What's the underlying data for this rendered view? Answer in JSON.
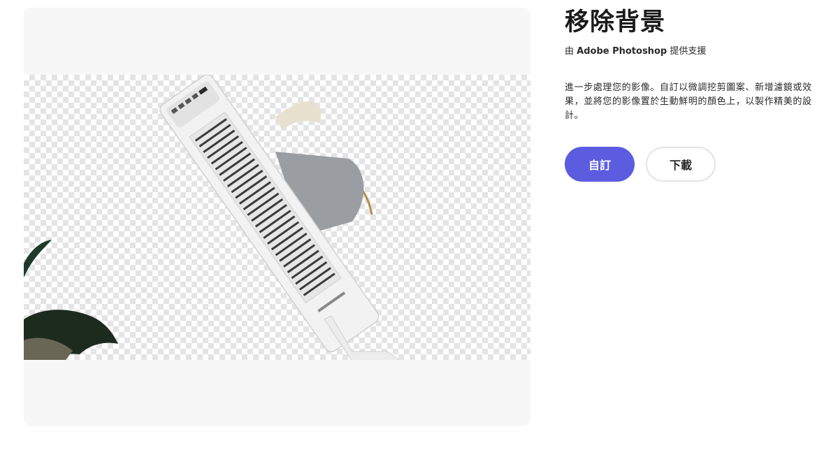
{
  "tool": {
    "title": "移除背景",
    "powered_by_prefix": "由 ",
    "powered_by_brand": "Adobe Photoshop",
    "powered_by_suffix": " 提供支援",
    "description": "進一步處理您的影像。自訂以微調挖剪圖案、新增濾鏡或效果，並將您的影像置於生動鮮明的顏色上，以製作精美的設計。"
  },
  "actions": {
    "customize_label": "自訂",
    "download_label": "下載"
  },
  "colors": {
    "primary_button": "#5c5ce0",
    "panel_background": "#f7f7f7",
    "checker_light": "#ffffff",
    "checker_dark": "#e4e4e4"
  },
  "preview": {
    "subject": "tower-fan-with-background-removed"
  }
}
